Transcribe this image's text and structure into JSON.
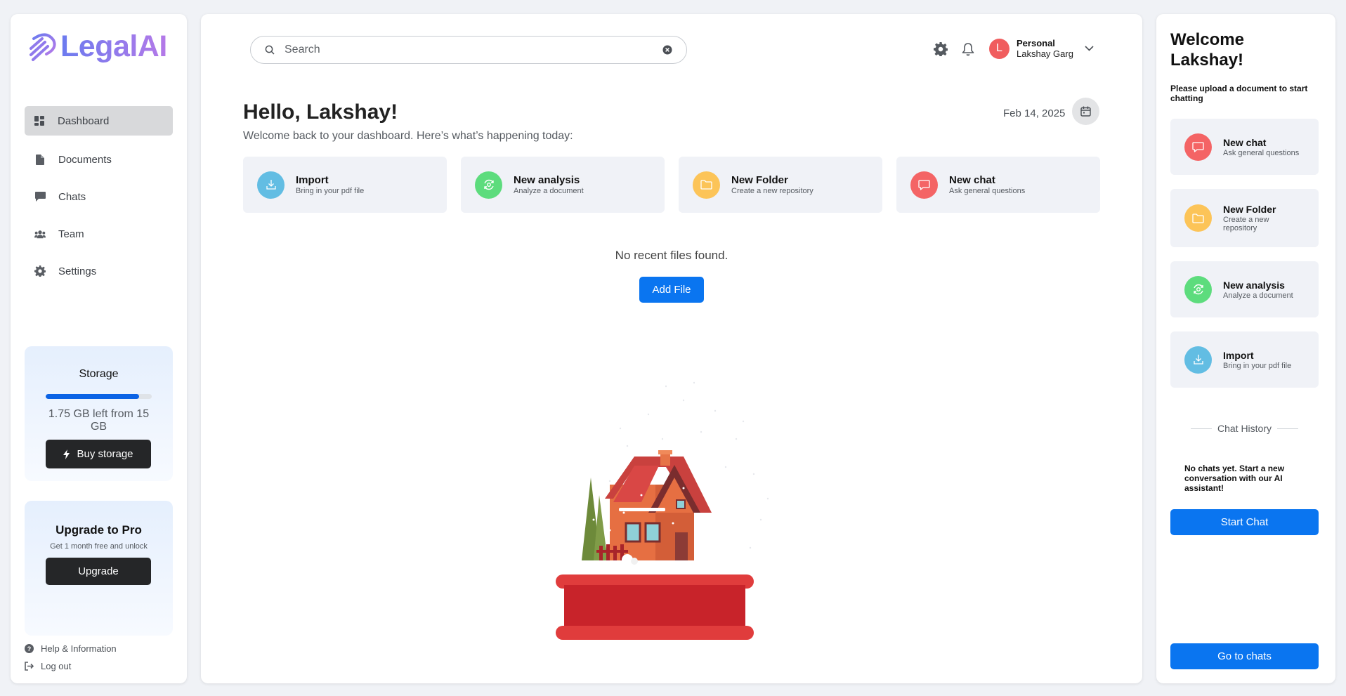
{
  "app": {
    "name": "LegalAI"
  },
  "sidebar": {
    "items": [
      {
        "label": "Dashboard",
        "icon": "dashboard-icon",
        "active": true
      },
      {
        "label": "Documents",
        "icon": "document-icon"
      },
      {
        "label": "Chats",
        "icon": "chat-icon"
      },
      {
        "label": "Team",
        "icon": "team-icon"
      },
      {
        "label": "Settings",
        "icon": "gear-icon"
      }
    ],
    "storage": {
      "title": "Storage",
      "used_fraction": 0.883,
      "text": "1.75 GB left from 15 GB",
      "button": "Buy storage"
    },
    "upgrade": {
      "title": "Upgrade to Pro",
      "subtitle": "Get 1 month free and unlock",
      "button": "Upgrade"
    },
    "footer": {
      "help": "Help & Information",
      "logout": "Log out"
    }
  },
  "header": {
    "search_placeholder": "Search",
    "user": {
      "initial": "L",
      "account_type": "Personal",
      "name": "Lakshay Garg"
    }
  },
  "main": {
    "greeting": "Hello, Lakshay!",
    "subtitle": "Welcome back to your dashboard. Here’s what’s happening today:",
    "date": "Feb 14, 2025",
    "actions": [
      {
        "title": "Import",
        "sub": "Bring in your pdf file",
        "color": "#62bde3",
        "icon": "download-icon"
      },
      {
        "title": "New analysis",
        "sub": "Analyze a document",
        "color": "#5ddc7d",
        "icon": "analysis-icon"
      },
      {
        "title": "New Folder",
        "sub": "Create a new repository",
        "color": "#fcc458",
        "icon": "folder-icon"
      },
      {
        "title": "New chat",
        "sub": "Ask general questions",
        "color": "#f46465",
        "icon": "chat-icon"
      }
    ],
    "empty_text": "No recent files found.",
    "add_file": "Add File"
  },
  "right": {
    "welcome": "Welcome Lakshay!",
    "upload_note": "Please upload a document to start chatting",
    "cards": [
      {
        "title": "New chat",
        "sub": "Ask general questions",
        "color": "#f46465",
        "icon": "chat-icon"
      },
      {
        "title": "New Folder",
        "sub": "Create a new repository",
        "color": "#fcc458",
        "icon": "folder-icon"
      },
      {
        "title": "New analysis",
        "sub": "Analyze a document",
        "color": "#5ddc7d",
        "icon": "analysis-icon"
      },
      {
        "title": "Import",
        "sub": "Bring in your pdf file",
        "color": "#62bde3",
        "icon": "download-icon"
      }
    ],
    "history_label": "Chat History",
    "no_chats": "No chats yet. Start a new conversation with our AI assistant!",
    "start_chat": "Start Chat",
    "go_to_chats": "Go to chats"
  }
}
